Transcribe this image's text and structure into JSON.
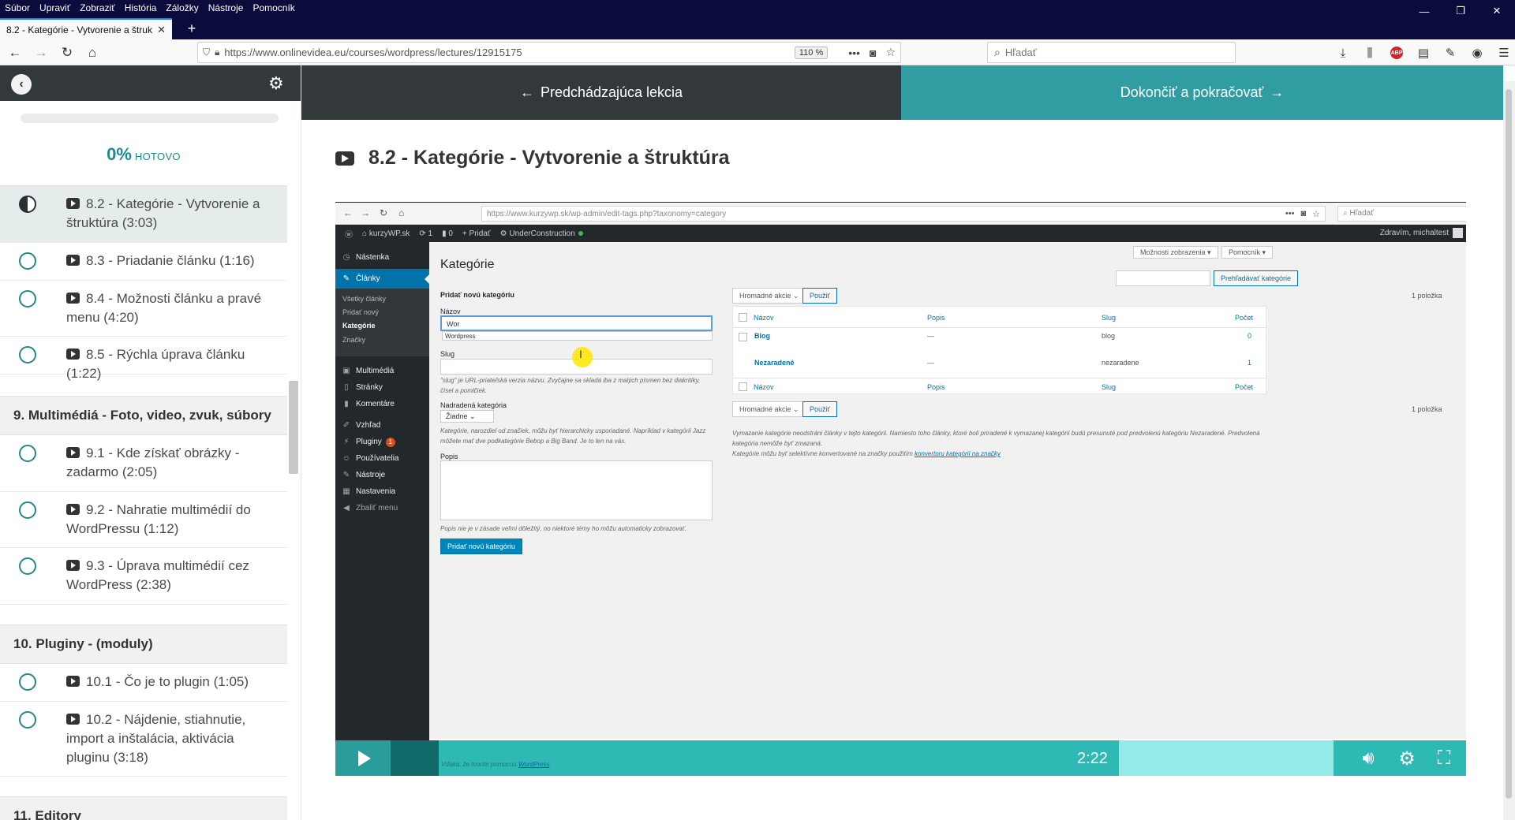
{
  "browser": {
    "menu": [
      "Súbor",
      "Upraviť",
      "Zobraziť",
      "História",
      "Záložky",
      "Nástroje",
      "Pomocník"
    ],
    "tab_title": "8.2 - Kategórie - Vytvorenie a štrukt",
    "url": "https://www.onlinevidea.eu/courses/wordpress/lectures/12915175",
    "zoom": "110 %",
    "search_placeholder": "Hľadať"
  },
  "sidebar": {
    "progress_value": "0%",
    "progress_label": "HOTOVO",
    "lessons": [
      {
        "label": "8.2 - Kategórie - Vytvorenie a štruktúra (3:03)",
        "state": "in-progress"
      },
      {
        "label": "8.3 - Priadanie článku (1:16)",
        "state": "not-started"
      },
      {
        "label": "8.4 - Možnosti článku a pravé menu (4:20)",
        "state": "not-started"
      },
      {
        "label": "8.5 - Rýchla úprava článku (1:22)",
        "state": "not-started"
      },
      {
        "label": "9.1 - Kde získať obrázky - zadarmo (2:05)",
        "state": "not-started"
      },
      {
        "label": "9.2 - Nahratie multimédií do WordPressu (1:12)",
        "state": "not-started"
      },
      {
        "label": "9.3 - Úprava multimédií cez WordPress (2:38)",
        "state": "not-started"
      },
      {
        "label": "10.1 - Čo je to plugin (1:05)",
        "state": "not-started"
      },
      {
        "label": "10.2 - Nájdenie, stiahnutie, import a inštalácia, aktivácia pluginu (3:18)",
        "state": "not-started"
      }
    ],
    "sections": [
      "9. Multimédiá - Foto, video, zvuk, súbory",
      "10. Pluginy - (moduly)",
      "11. Editory"
    ]
  },
  "nav": {
    "prev": "Predchádzajúca lekcia",
    "next": "Dokončiť a pokračovať"
  },
  "lecture_title": "8.2 - Kategórie - Vytvorenie a štruktúra",
  "video": {
    "browser_url": "https://www.kurzywp.sk/wp-admin/edit-tags.php?taxonomy=category",
    "browser_search": "Hľadať",
    "adminbar": {
      "site": "kurzyWP.sk",
      "updates": "1",
      "comments": "0",
      "new": "Pridať",
      "plugin": "UnderConstruction",
      "greeting": "Zdravím, michaltest"
    },
    "menu": {
      "dashboard": "Nástenka",
      "posts": "Články",
      "sub_all": "Všetky články",
      "sub_new": "Pridať nový",
      "sub_categories": "Kategórie",
      "sub_tags": "Značky",
      "media": "Multimédiá",
      "pages": "Stránky",
      "comments": "Komentáre",
      "appearance": "Vzhľad",
      "plugins": "Pluginy",
      "plugins_badge": "1",
      "users": "Používatelia",
      "tools": "Nástroje",
      "settings": "Nastavenia",
      "collapse": "Zbaliť menu"
    },
    "page_title": "Kategórie",
    "screen_options": "Možnosti zobrazenia ▾",
    "help": "Pomocník ▾",
    "search_button": "Prehľadávať kategórie",
    "add_heading": "Pridať novú kategóriu",
    "name_label": "Názov",
    "name_value": "Wor",
    "autocomplete": "Wordpress",
    "slug_label": "Slug",
    "slug_help": "\"slug\" je URL-priateľská verzia názvu. Zvyčajne sa skladá iba z malých písmen bez diakritiky, čísel a pomlčiek.",
    "parent_label": "Nadradená kategória",
    "parent_value": "Žiadne",
    "parent_help": "Kategórie, narozdiel od značiek, môžu byť hierarchicky usporiadané. Napríklad v kategórii Jazz môžete mať dve podkategórie Bebop a Big Band. Je to len na vás.",
    "desc_label": "Popis",
    "desc_help": "Popis nie je v zásade veľmi dôležitý, no niektoré témy ho môžu automaticky zobrazovať.",
    "submit": "Pridať novú kategóriu",
    "bulk_actions": "Hromadné akcie",
    "apply": "Použiť",
    "count_label": "1 položka",
    "columns": [
      "Názov",
      "Popis",
      "Slug",
      "Počet"
    ],
    "rows": [
      {
        "name": "Blog",
        "desc": "—",
        "slug": "blog",
        "count": "0"
      },
      {
        "name": "Nezaradené",
        "desc": "—",
        "slug": "nezaradene",
        "count": "1"
      }
    ],
    "note1": "Vymazanie kategórie neodstráni články v tejto kategórii. Namiesto toho články, ktoré boli priradené k vymazanej kategórii budú presunuté pod predvolenú kategóriu Nezaradené. Predvolená kategória nemôže byť zmazaná.",
    "note2_prefix": "Kategórie môžu byť selektívne konvertované na značky použitím",
    "note2_link": "konvertoru kategórií na značky",
    "footer_prefix": "Vďaka, že tvoríte pomocou",
    "footer_link": "WordPress",
    "timecode": "2:22",
    "played_fraction": 0.045,
    "buffered_fraction": 0.19
  },
  "colors": {
    "accent": "#2f9da2",
    "dark": "#33383b",
    "control_bar": "#2fb9b5"
  }
}
